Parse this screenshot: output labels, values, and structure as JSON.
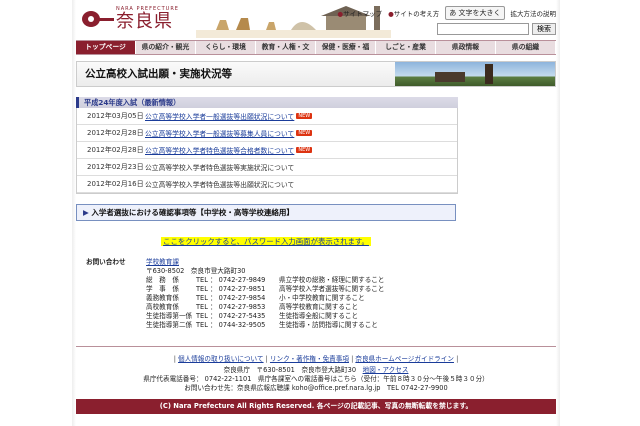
{
  "header": {
    "logo_en": "NARA PREFECTURE",
    "logo_ja": "奈良県",
    "util_links": [
      "サイトマップ",
      "サイトの考え方"
    ],
    "font_button": "文字を大きく",
    "expand_help": "拡大方法の説明",
    "search_button": "検索",
    "search_value": ""
  },
  "nav": [
    "トップページ",
    "県の紹介・観光",
    "くらし・環境",
    "教育・人権・文",
    "保健・医療・福",
    "しごと・産業",
    "県政情報",
    "県の組織"
  ],
  "page_title": "公立高校入試出願・実施状況等",
  "section": {
    "heading": "平成24年度入試（最新情報）",
    "rows": [
      {
        "date": "2012年03月05日",
        "text": "公立高等学校入学者一般選抜等出願状況について",
        "new": true,
        "linked": true
      },
      {
        "date": "2012年02月28日",
        "text": "公立高等学校入学者一般選抜等募集人員について",
        "new": true,
        "linked": true
      },
      {
        "date": "2012年02月28日",
        "text": "公立高等学校入学者特色選抜等合格者数について",
        "new": true,
        "linked": true
      },
      {
        "date": "2012年02月23日",
        "text": "公立高等学校入学者特色選抜等実施状況について",
        "new": false,
        "linked": false
      },
      {
        "date": "2012年02月16日",
        "text": "公立高等学校入学者特色選抜等出願状況について",
        "new": false,
        "linked": false
      }
    ],
    "new_badge": "NEW"
  },
  "confirm_box": "入学者選抜における確認事項等【中学校・高等学校連絡用】",
  "click_notice": "ここをクリックすると、パスワード入力画面が表示されます。",
  "contact": {
    "label": "お問い合わせ",
    "dept": "学校教育課",
    "address": "〒630-8502　奈良市登大路町30",
    "rows": [
      {
        "name": "総　務　係",
        "tel": "TEL ： 0742-27-9849",
        "desc": "県立学校の総務・経理に関すること"
      },
      {
        "name": "学　事　係",
        "tel": "TEL ： 0742-27-9851",
        "desc": "高等学校入学者選抜等に関すること"
      },
      {
        "name": "義務教育係",
        "tel": "TEL ： 0742-27-9854",
        "desc": "小・中学校教育に関すること"
      },
      {
        "name": "高校教育係",
        "tel": "TEL ： 0742-27-9853",
        "desc": "高等学校教育に関すること"
      },
      {
        "name": "生徒指導第一係",
        "tel": "TEL ： 0742-27-5435",
        "desc": "生徒指導全般に関すること"
      },
      {
        "name": "生徒指導第二係",
        "tel": "TEL ： 0744-32-9505",
        "desc": "生徒指導・訪問指導に関すること"
      }
    ]
  },
  "footer": {
    "links": [
      "個人情報の取り扱いについて",
      "リンク・著作権・免責事項",
      "奈良県ホームページガイドライン"
    ],
    "line1": "奈良県庁　〒630-8501　奈良市登大路町30",
    "access": "地図・アクセス",
    "line2": "県庁代表電話番号： 0742-22-1101　県庁各課室への電話番号はこちら（受付：午前８時３０分〜午後５時３０分）",
    "line3": "お問い合わせ先：奈良県広報広聴課 koho@office.pref.nara.lg.jp　TEL 0742-27-9900",
    "copyright": "(C) Nara Prefecture All Rights Reserved. 各ページの記載記事、写真の無断転載を禁じます。"
  }
}
